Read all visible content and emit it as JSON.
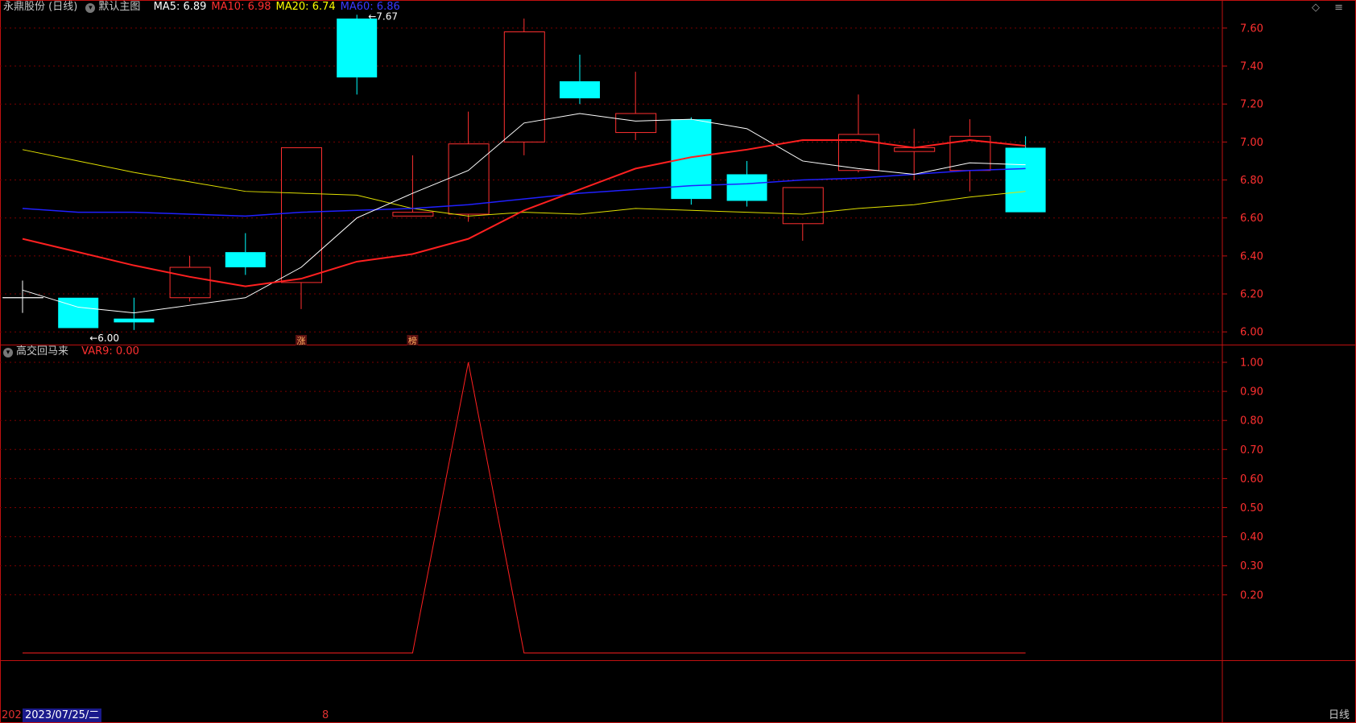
{
  "header": {
    "stock": "永鼎股份 (日线)",
    "template": "默认主图",
    "ma_labels": [
      {
        "text": "MA5: 6.89",
        "color": "#ffffff"
      },
      {
        "text": "MA10: 6.98",
        "color": "#ff3030"
      },
      {
        "text": "MA20: 6.74",
        "color": "#ffff00"
      },
      {
        "text": "MA60: 6.86",
        "color": "#3a3aff"
      }
    ]
  },
  "indicator": {
    "name": "高交回马来",
    "var_label": "VAR9: 0.00",
    "var_color": "#ff3030"
  },
  "controls": {
    "diamond": "◇",
    "menu": "≡"
  },
  "footer": {
    "year_prefix": "202",
    "date": "2023/07/25/二",
    "tick": "8",
    "period": "日线"
  },
  "colors": {
    "up": "#ff3030",
    "down": "#00ffff",
    "grid": "#7a0000",
    "axis": "#c01010",
    "ma5": "#ffffff",
    "ma10": "#ff2020",
    "ma20": "#e0e000",
    "ma60": "#2020ff"
  },
  "chart_data": [
    {
      "type": "candlestick",
      "ylim": [
        5.95,
        7.68
      ],
      "yticks": [
        "6.00",
        "6.20",
        "6.40",
        "6.60",
        "6.80",
        "7.00",
        "7.20",
        "7.40",
        "7.60"
      ],
      "candles": [
        {
          "o": 6.18,
          "h": 6.27,
          "l": 6.1,
          "c": 6.18
        },
        {
          "o": 6.18,
          "h": 6.18,
          "l": 6.02,
          "c": 6.02
        },
        {
          "o": 6.07,
          "h": 6.18,
          "l": 6.01,
          "c": 6.05
        },
        {
          "o": 6.18,
          "h": 6.4,
          "l": 6.16,
          "c": 6.34
        },
        {
          "o": 6.42,
          "h": 6.52,
          "l": 6.3,
          "c": 6.34
        },
        {
          "o": 6.26,
          "h": 6.97,
          "l": 6.12,
          "c": 6.97
        },
        {
          "o": 7.65,
          "h": 7.67,
          "l": 7.25,
          "c": 7.34
        },
        {
          "o": 6.61,
          "h": 6.93,
          "l": 6.61,
          "c": 6.63
        },
        {
          "o": 6.62,
          "h": 7.16,
          "l": 6.58,
          "c": 6.99
        },
        {
          "o": 7.0,
          "h": 7.65,
          "l": 6.93,
          "c": 7.58
        },
        {
          "o": 7.32,
          "h": 7.46,
          "l": 7.2,
          "c": 7.23
        },
        {
          "o": 7.05,
          "h": 7.37,
          "l": 7.01,
          "c": 7.15
        },
        {
          "o": 7.12,
          "h": 7.13,
          "l": 6.67,
          "c": 6.7
        },
        {
          "o": 6.83,
          "h": 6.9,
          "l": 6.66,
          "c": 6.69
        },
        {
          "o": 6.57,
          "h": 6.76,
          "l": 6.48,
          "c": 6.76
        },
        {
          "o": 6.85,
          "h": 7.25,
          "l": 6.84,
          "c": 7.04
        },
        {
          "o": 6.95,
          "h": 7.07,
          "l": 6.8,
          "c": 6.97
        },
        {
          "o": 6.85,
          "h": 7.12,
          "l": 6.74,
          "c": 7.03
        },
        {
          "o": 6.97,
          "h": 7.03,
          "l": 6.63,
          "c": 6.63
        }
      ],
      "ma5": [
        6.22,
        6.13,
        6.1,
        6.14,
        6.18,
        6.34,
        6.6,
        6.73,
        6.85,
        7.1,
        7.15,
        7.11,
        7.12,
        7.07,
        6.9,
        6.86,
        6.83,
        6.89,
        6.88
      ],
      "ma10": [
        6.49,
        6.42,
        6.35,
        6.29,
        6.24,
        6.28,
        6.37,
        6.41,
        6.49,
        6.64,
        6.75,
        6.86,
        6.92,
        6.96,
        7.01,
        7.01,
        6.97,
        7.01,
        6.98
      ],
      "ma20": [
        6.96,
        6.9,
        6.84,
        6.79,
        6.74,
        6.73,
        6.72,
        6.65,
        6.61,
        6.63,
        6.62,
        6.65,
        6.64,
        6.63,
        6.62,
        6.65,
        6.67,
        6.71,
        6.74
      ],
      "ma60": [
        6.65,
        6.63,
        6.63,
        6.62,
        6.61,
        6.63,
        6.64,
        6.65,
        6.67,
        6.7,
        6.73,
        6.75,
        6.77,
        6.78,
        6.8,
        6.81,
        6.83,
        6.85,
        6.86
      ],
      "annotations": [
        {
          "text": "7.67",
          "bar": 6,
          "y": 7.67
        },
        {
          "text": "6.00",
          "bar": 1,
          "y": 6.0
        }
      ],
      "markers": [
        {
          "text": "涨",
          "bar": 5
        },
        {
          "text": "榜",
          "bar": 7
        }
      ]
    },
    {
      "type": "line",
      "ylim": [
        0.0,
        1.06
      ],
      "yticks": [
        "0.20",
        "0.30",
        "0.40",
        "0.50",
        "0.60",
        "0.70",
        "0.80",
        "0.90",
        "1.00"
      ],
      "series": [
        {
          "values": [
            0,
            0,
            0,
            0,
            0,
            0,
            0,
            0,
            1,
            0,
            0,
            0,
            0,
            0,
            0,
            0,
            0,
            0,
            0
          ]
        }
      ]
    }
  ]
}
